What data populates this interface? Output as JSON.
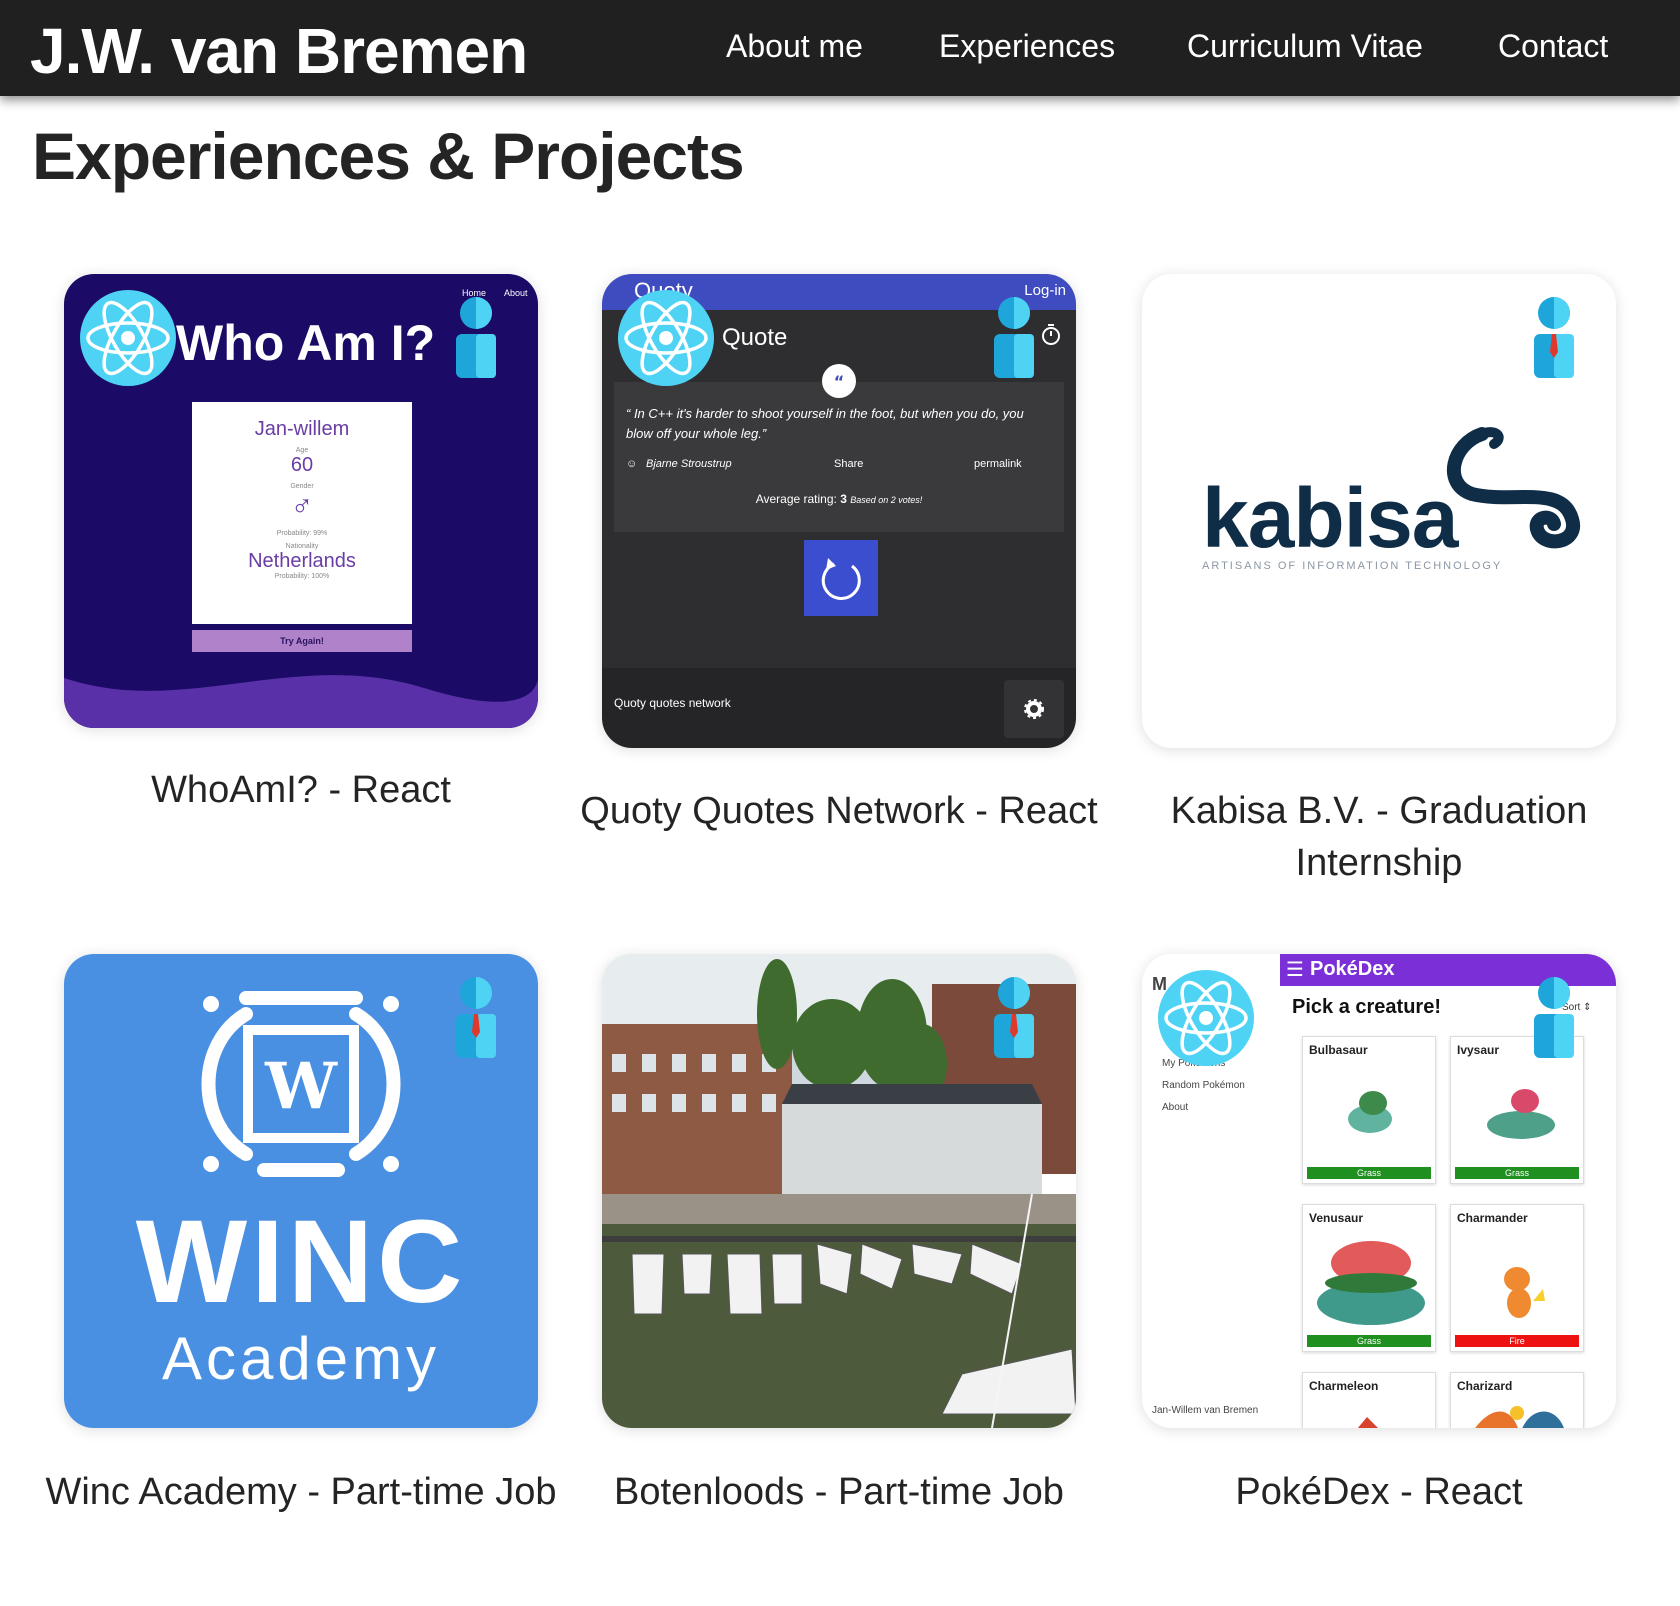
{
  "header": {
    "brand": "J.W. van Bremen",
    "nav": [
      "About me",
      "Experiences",
      "Curriculum Vitae",
      "Contact"
    ]
  },
  "page": {
    "heading": "Experiences & Projects"
  },
  "cards": [
    {
      "title": "WhoAmI? - React",
      "preview": {
        "heading": "Who Am I?",
        "nav": [
          "Home",
          "About"
        ],
        "name": "Jan-willem",
        "age_label": "Age",
        "age": "60",
        "gender_label": "Gender",
        "gender_symbol": "♂",
        "probability_gender": "Probability: 99%",
        "nationality_label": "Nationality",
        "nationality": "Netherlands",
        "probability_nat": "Probability: 100%",
        "button": "Try Again!"
      }
    },
    {
      "title": "Quoty Quotes Network - React",
      "preview": {
        "brand": "Quoty",
        "login": "Log-in",
        "section": "Quote",
        "quote": "“ In C++ it's harder to shoot yourself in the foot, but when you do, you blow off your whole leg.”",
        "author": "Bjarne Stroustrup",
        "share": "Share",
        "permalink": "permalink",
        "avg_label": "Average rating:",
        "avg_value": "3",
        "avg_votes": "Based on 2 votes!",
        "footer": "Quoty quotes network"
      }
    },
    {
      "title": "Kabisa B.V. - Graduation Internship",
      "preview": {
        "logo_text": "kabisa",
        "tagline": "ARTISANS OF INFORMATION TECHNOLOGY"
      }
    },
    {
      "title": "Winc Academy - Part-time Job",
      "preview": {
        "logo_word": "WINC",
        "logo_sub": "Academy",
        "logo_letter": "W"
      }
    },
    {
      "title": "Botenloods - Part-time Job",
      "preview": {}
    },
    {
      "title": "PokéDex - React",
      "preview": {
        "brand": "PokéDex",
        "pick": "Pick a creature!",
        "sort": "Sort ⇕",
        "side_letter": "M",
        "side_items": [
          "My Pokémons",
          "Random Pokémon",
          "About"
        ],
        "footer": "Jan-Willem van Bremen",
        "tiles": [
          {
            "name": "Bulbasaur",
            "type": "Grass"
          },
          {
            "name": "Ivysaur",
            "type": "Grass"
          },
          {
            "name": "Venusaur",
            "type": "Grass"
          },
          {
            "name": "Charmander",
            "type": "Fire"
          },
          {
            "name": "Charmeleon",
            "type": ""
          },
          {
            "name": "Charizard",
            "type": ""
          }
        ]
      }
    }
  ],
  "colors": {
    "header_bg": "#202020",
    "react": "#4fd3f5",
    "winc": "#4a90e2",
    "quoty": "#3f4cc0",
    "pokedex": "#7b2fd6",
    "grass": "#1f8f1f",
    "fire": "#ee1111"
  }
}
